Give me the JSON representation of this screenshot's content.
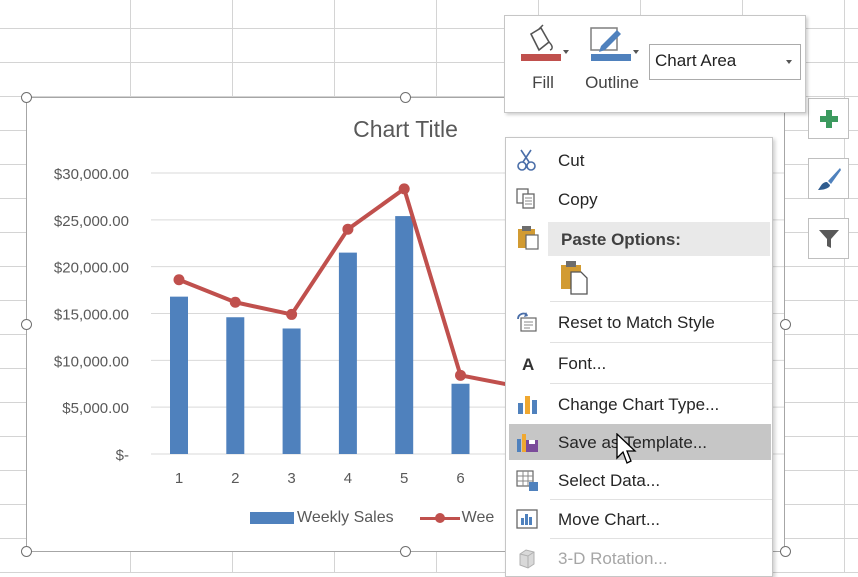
{
  "chart": {
    "title": "Chart Title",
    "legend": {
      "bar_series": "Weekly Sales",
      "line_series": "Wee"
    }
  },
  "chart_data": {
    "type": "bar",
    "title": "Chart Title",
    "categories": [
      "1",
      "2",
      "3",
      "4",
      "5",
      "6"
    ],
    "series": [
      {
        "name": "Weekly Sales",
        "type": "bar",
        "color": "#4f81bd",
        "values": [
          16800,
          14600,
          13400,
          21500,
          25400,
          7500
        ]
      },
      {
        "type": "line",
        "color": "#c0504d",
        "values": [
          18600,
          16200,
          14900,
          24000,
          28300,
          8400
        ]
      }
    ],
    "yticks": [
      "$30,000.00",
      "$25,000.00",
      "$20,000.00",
      "$15,000.00",
      "$10,000.00",
      "$5,000.00",
      "$-"
    ],
    "ylim": [
      0,
      30000
    ],
    "grid": true,
    "legend_position": "bottom"
  },
  "mini_toolbar": {
    "fill_label": "Fill",
    "outline_label": "Outline",
    "element_select_value": "Chart Area",
    "fill_color": "#c0504d",
    "outline_color": "#4f81bd"
  },
  "side_buttons": {
    "elements_icon": "plus-icon",
    "styles_icon": "brush-icon",
    "filter_icon": "funnel-icon"
  },
  "context_menu": {
    "cut": "Cut",
    "copy": "Copy",
    "paste_options": "Paste Options:",
    "reset": "Reset to Match Style",
    "font": "Font...",
    "change_type": "Change Chart Type...",
    "save_template": "Save as Template...",
    "select_data": "Select Data...",
    "move_chart": "Move Chart...",
    "rotation": "3-D Rotation..."
  }
}
